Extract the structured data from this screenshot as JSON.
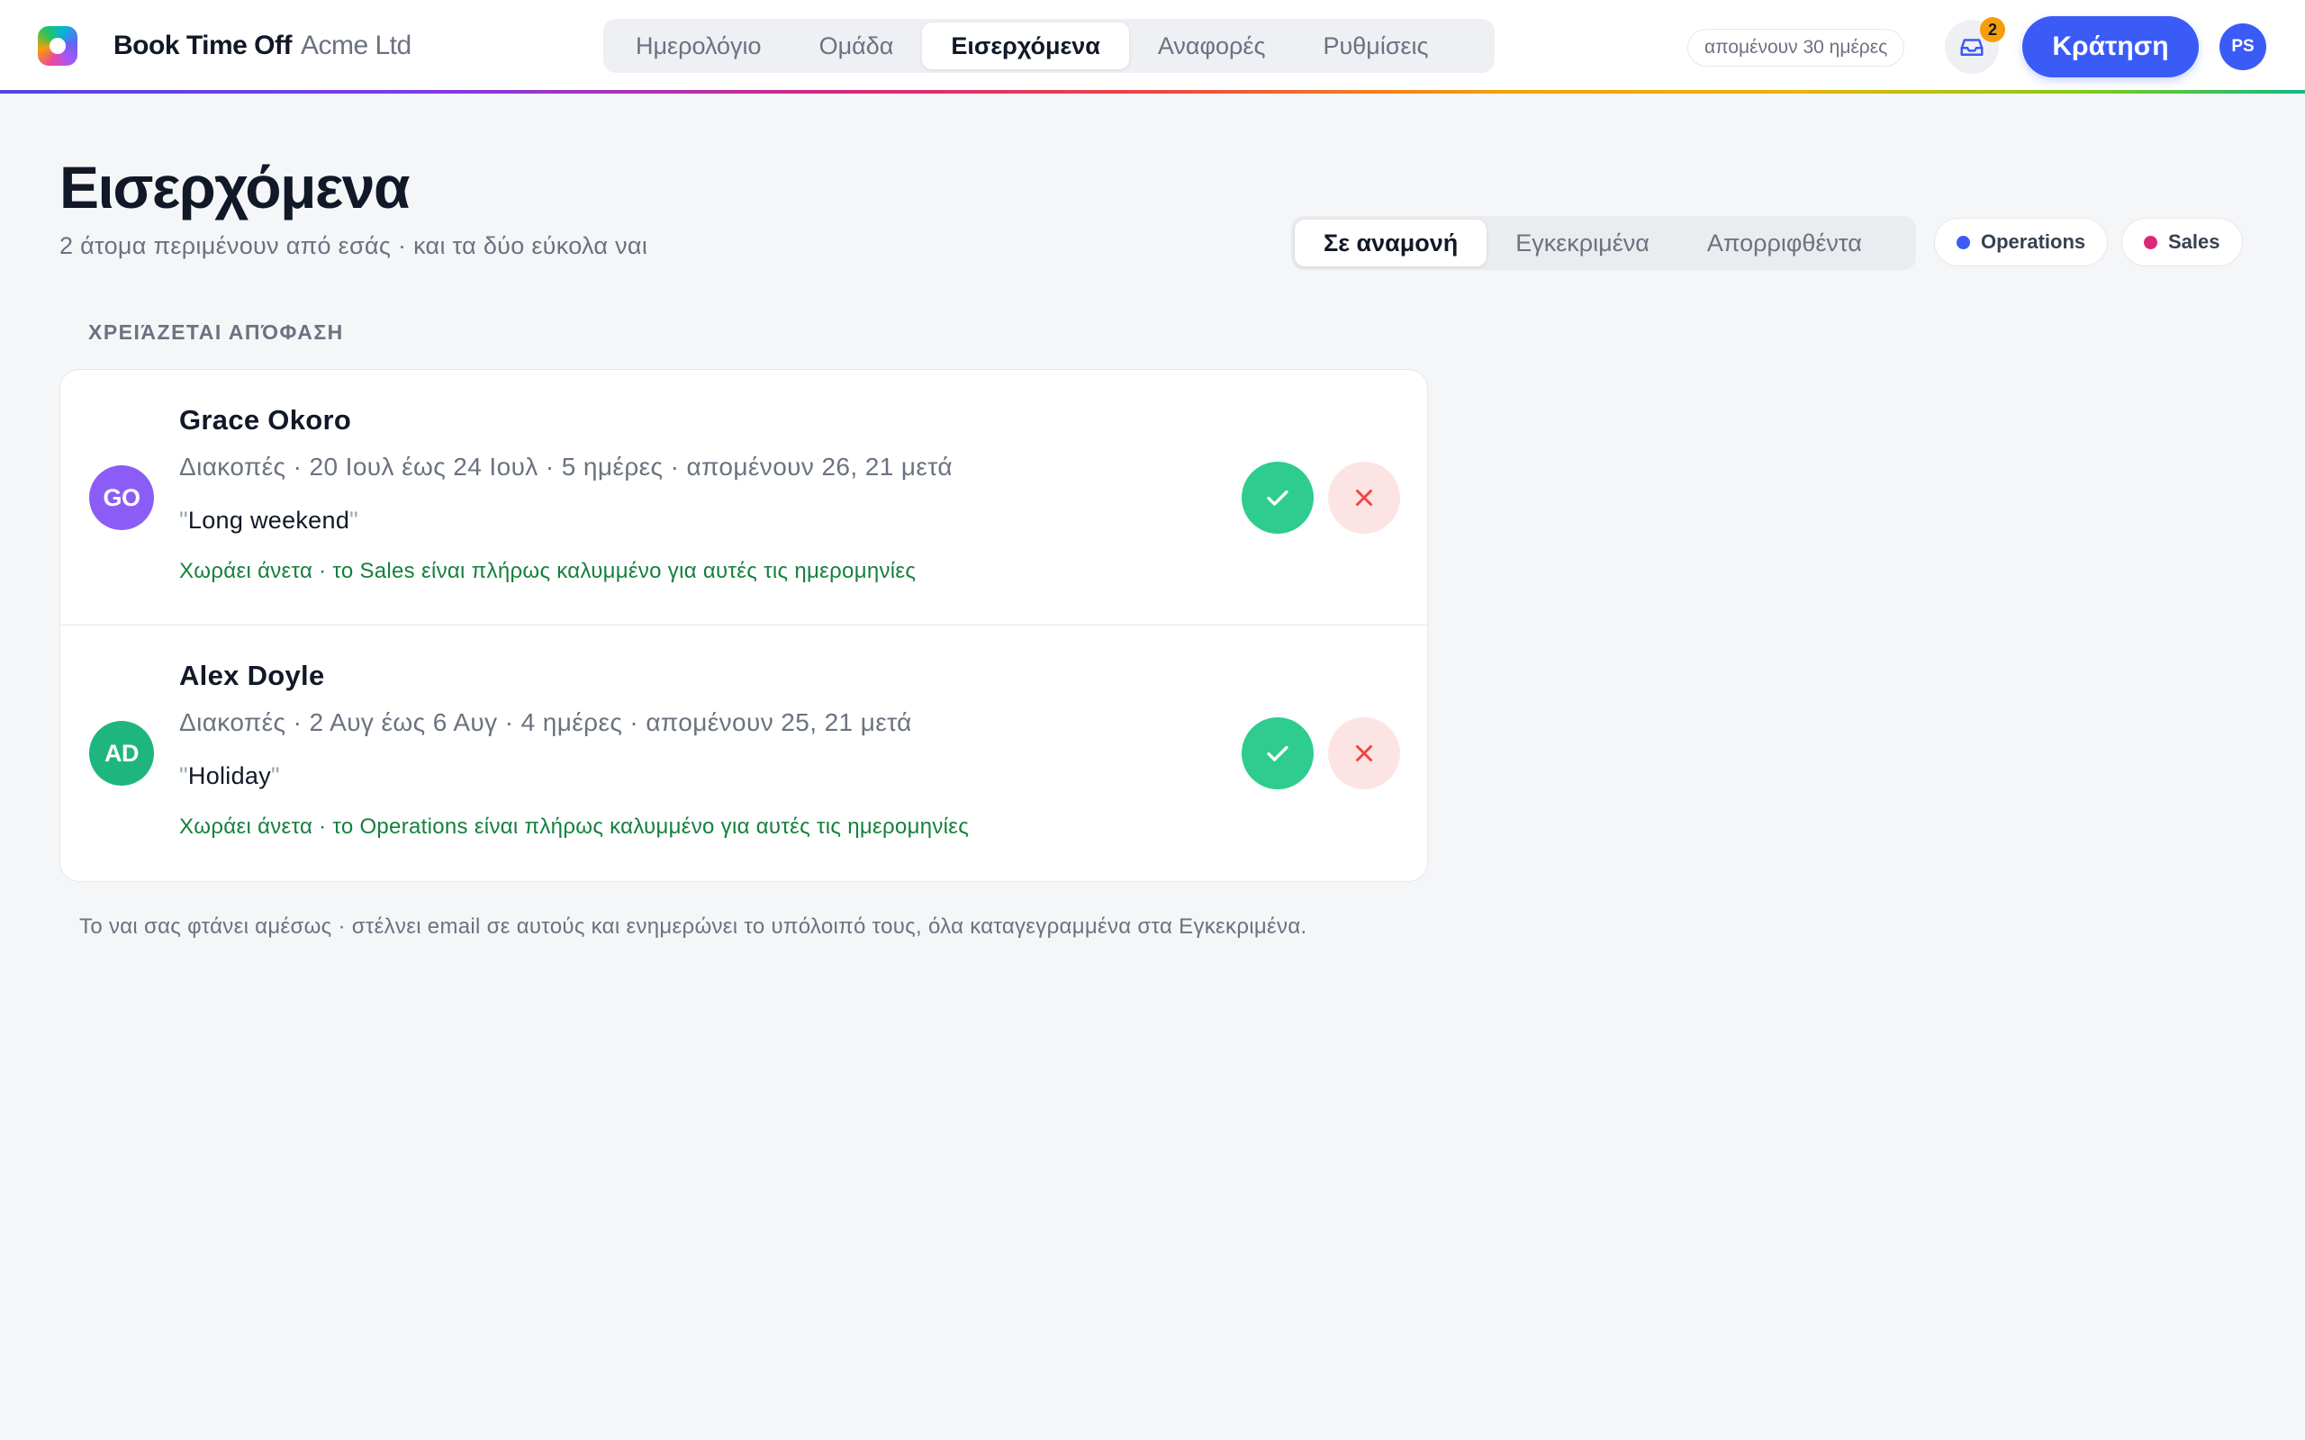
{
  "app": {
    "brand_name": "Book Time Off",
    "company": "Acme Ltd",
    "logo_icon": "app-logo-icon"
  },
  "nav": {
    "tabs": [
      {
        "label": "Ημερολόγιο",
        "active": false
      },
      {
        "label": "Ομάδα",
        "active": false
      },
      {
        "label": "Εισερχόμενα",
        "active": true
      },
      {
        "label": "Αναφορές",
        "active": false
      },
      {
        "label": "Ρυθμίσεις",
        "active": false
      }
    ]
  },
  "header": {
    "days_left": "απομένουν 30 ημέρες",
    "inbox_icon": "inbox-icon",
    "inbox_count": "2",
    "book_label": "Κράτηση",
    "user_initials": "PS",
    "accent_color": "#3b5bf6"
  },
  "page": {
    "title": "Εισερχόμενα",
    "subtitle": "2 άτομα περιμένουν από εσάς · και τα δύο εύκολα ναι"
  },
  "filters": {
    "tabs": [
      {
        "label": "Σε αναμονή",
        "active": true
      },
      {
        "label": "Εγκεκριμένα",
        "active": false
      },
      {
        "label": "Απορριφθέντα",
        "active": false
      }
    ],
    "teams": [
      {
        "label": "Operations",
        "color": "#3b5bf6"
      },
      {
        "label": "Sales",
        "color": "#db2777"
      }
    ]
  },
  "section": {
    "label": "ΧΡΕΙΆΖΕΤΑΙ ΑΠΌΦΑΣΗ"
  },
  "requests": [
    {
      "initials": "GO",
      "avatar_color": "#8b5cf6",
      "name": "Grace Okoro",
      "meta": "Διακοπές · 20 Ιουλ έως 24 Ιουλ · 5 ημέρες · απομένουν 26, 21 μετά",
      "note": "Long weekend",
      "fit": "Χωράει άνετα · το Sales είναι πλήρως καλυμμένο για αυτές τις ημερομηνίες",
      "approve_icon": "check-icon",
      "reject_icon": "close-icon"
    },
    {
      "initials": "AD",
      "avatar_color": "#1fb57f",
      "name": "Alex Doyle",
      "meta": "Διακοπές · 2 Αυγ έως 6 Αυγ · 4 ημέρες · απομένουν 25, 21 μετά",
      "note": "Holiday",
      "fit": "Χωράει άνετα · το Operations είναι πλήρως καλυμμένο για αυτές τις ημερομηνίες",
      "approve_icon": "check-icon",
      "reject_icon": "close-icon"
    }
  ],
  "footnote": "Το ναι σας φτάνει αμέσως · στέλνει email σε αυτούς και ενημερώνει το υπόλοιπό τους, όλα καταγεγραμμένα στα Εγκεκριμένα.",
  "quote_mark": "\""
}
